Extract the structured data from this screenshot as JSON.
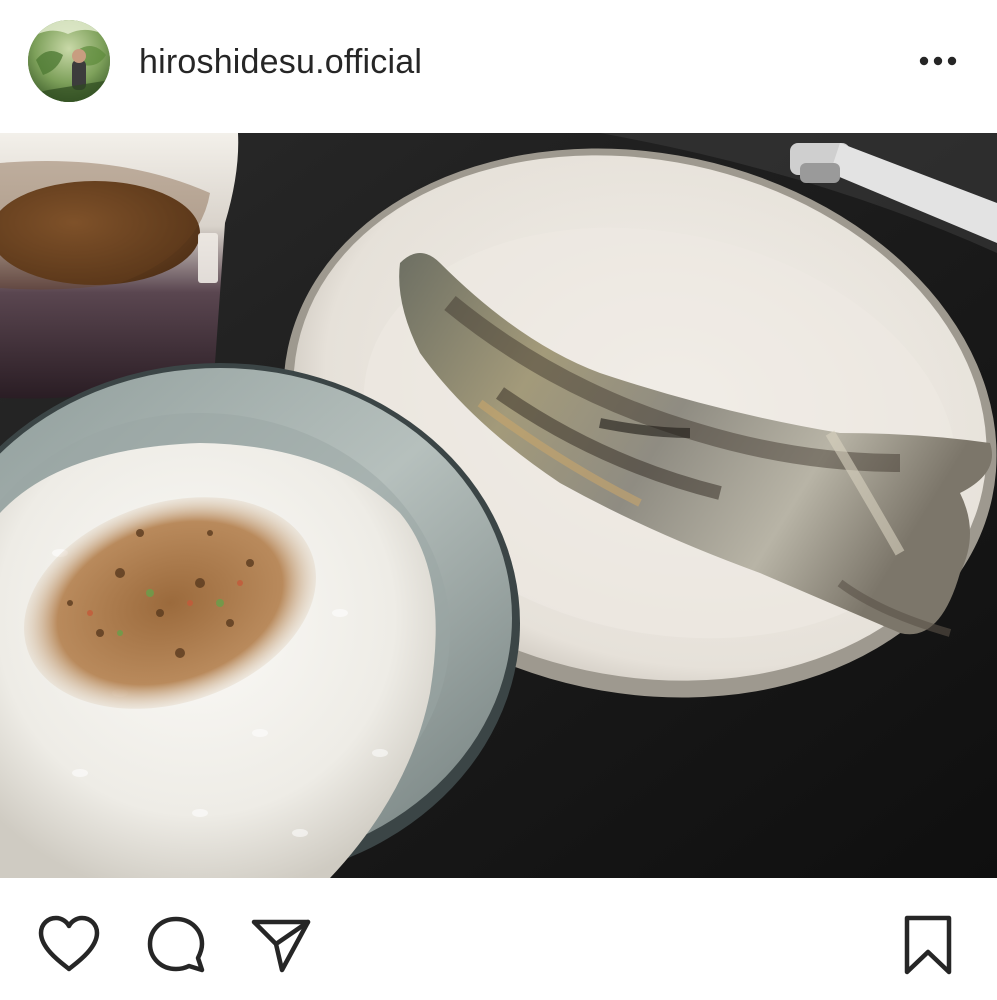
{
  "post": {
    "username": "hiroshidesu.official",
    "avatar_icon": "profile-photo",
    "more_icon": "ellipsis-icon"
  },
  "photo": {
    "subject": "food-photo"
  },
  "actions": {
    "like_icon": "heart-icon",
    "comment_icon": "comment-bubble-icon",
    "share_icon": "paper-plane-icon",
    "save_icon": "bookmark-icon"
  },
  "colors": {
    "text": "#262626",
    "background": "#ffffff",
    "icon_stroke": "#262626"
  }
}
